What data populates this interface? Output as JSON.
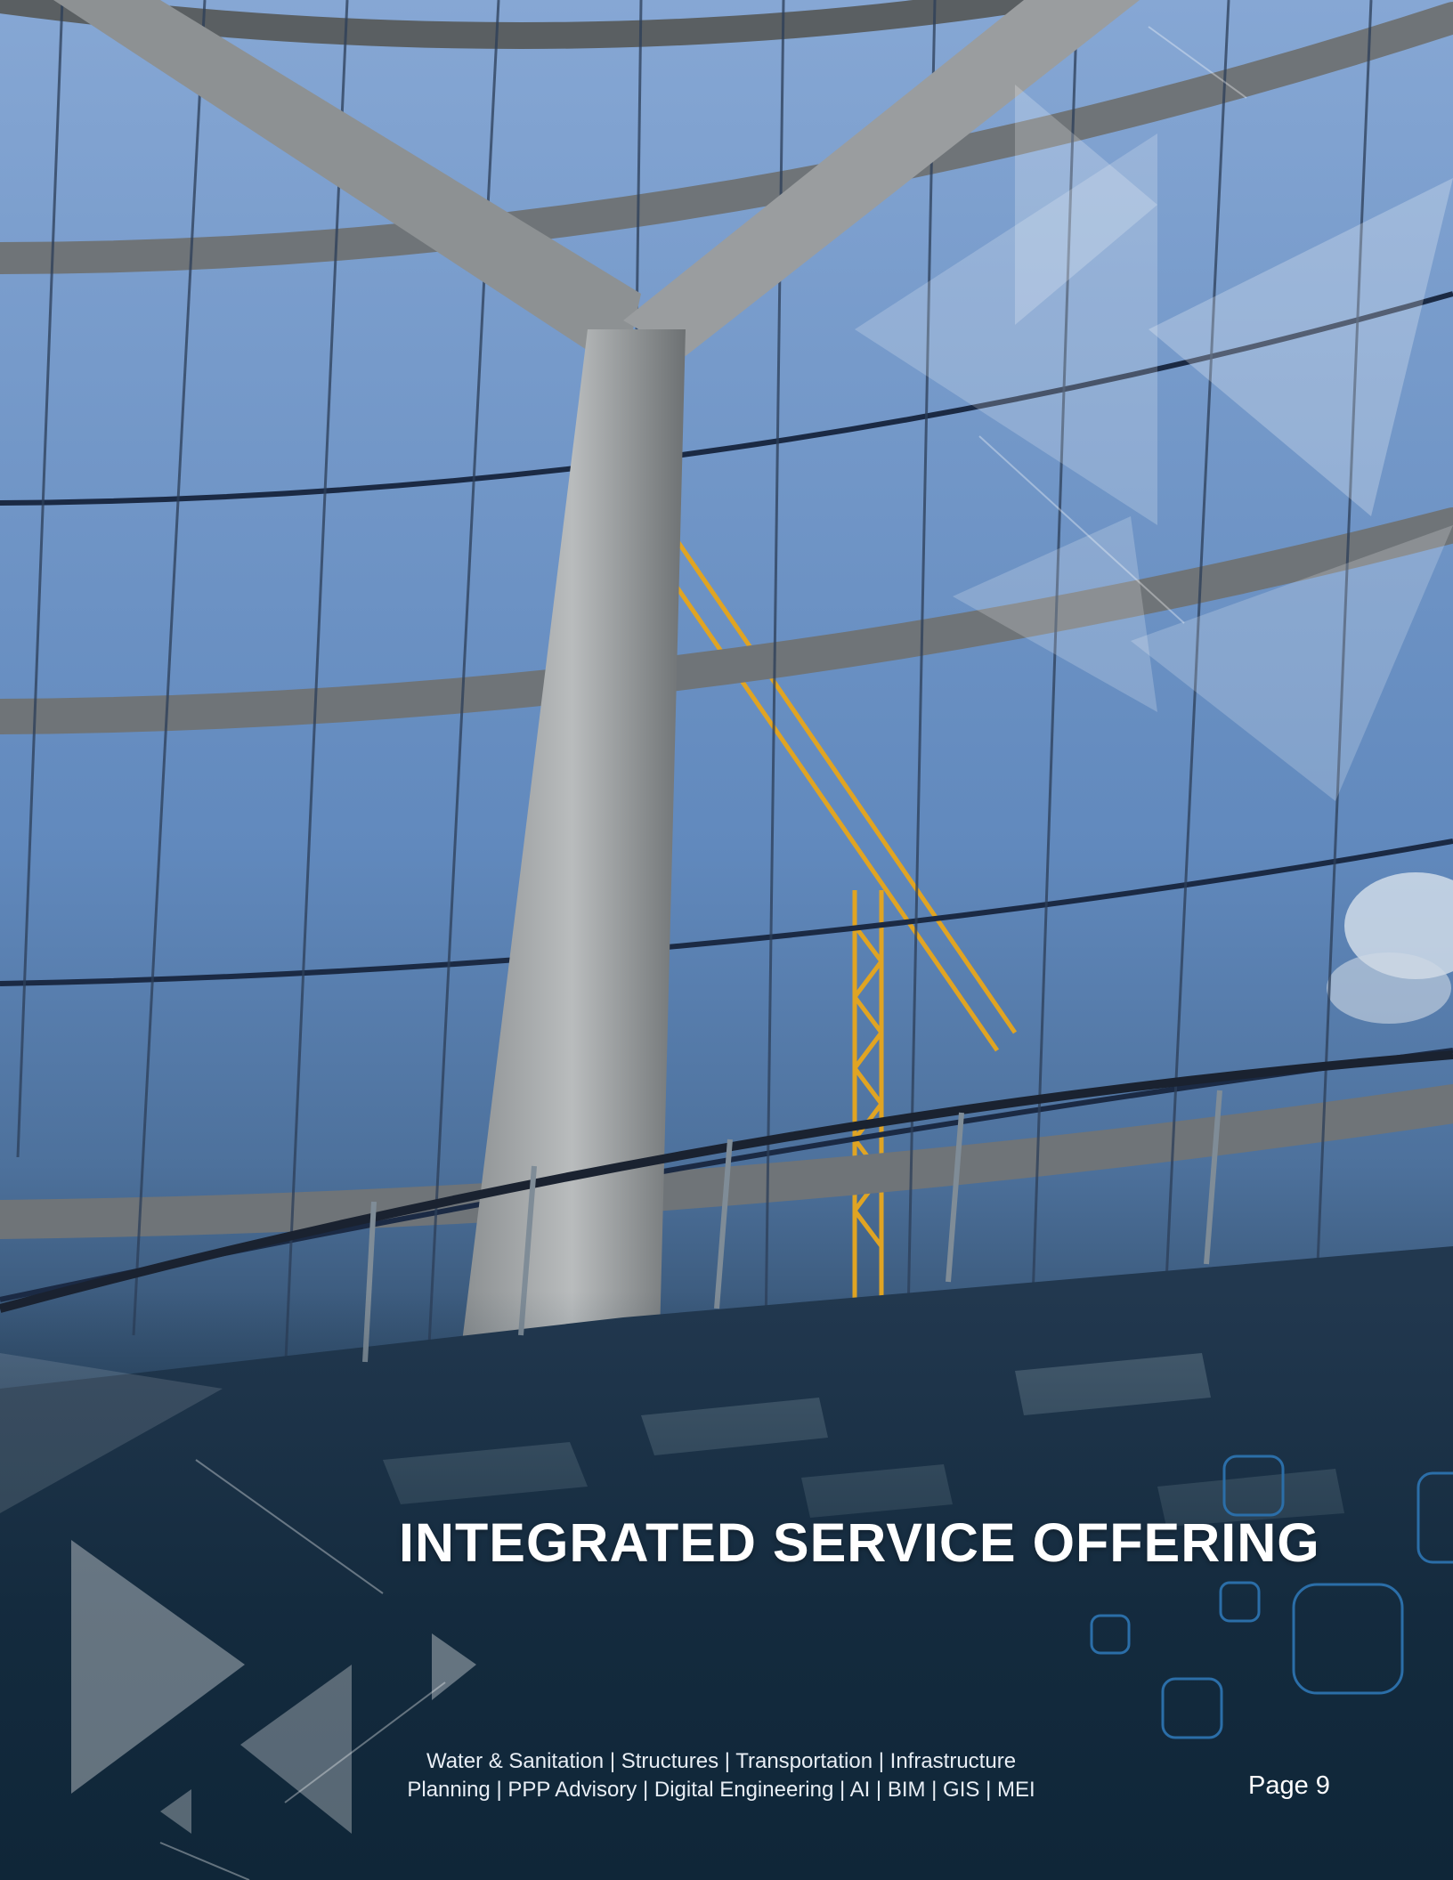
{
  "document": {
    "title": "INTEGRATED SERVICE OFFERING",
    "services_line_1": "Water & Sanitation | Structures | Transportation | Infrastructure",
    "services_line_2": "Planning | PPP Advisory | Digital Engineering | AI | BIM | GIS | MEI",
    "page_number": "Page 9"
  },
  "colors": {
    "sky_top": "#7d9fcf",
    "footer_navy": "#0f2638",
    "steel_frame": "#6f7478",
    "accent_blue": "#2b6ea8",
    "crane_yellow": "#e0a423"
  },
  "images": {
    "cover_photo": "glass-atrium-with-steel-frame-and-crane",
    "overlay_decor": "translucent-triangle-arrows-and-rounded-squares"
  }
}
